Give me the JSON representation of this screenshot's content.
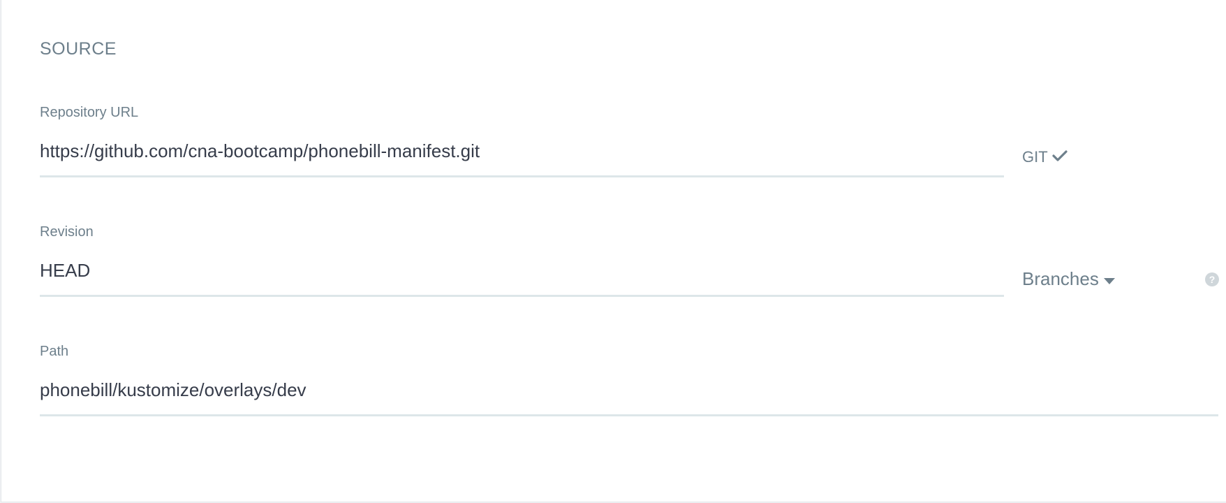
{
  "section": {
    "title": "SOURCE"
  },
  "repository": {
    "label": "Repository URL",
    "value": "https://github.com/cna-bootcamp/phonebill-manifest.git",
    "type_label": "GIT"
  },
  "revision": {
    "label": "Revision",
    "value": "HEAD",
    "selector_label": "Branches"
  },
  "path": {
    "label": "Path",
    "value": "phonebill/kustomize/overlays/dev"
  },
  "help": {
    "glyph": "?"
  },
  "colors": {
    "label": "#6d7f8b",
    "text": "#363c4a",
    "underline": "#dde6e9"
  }
}
